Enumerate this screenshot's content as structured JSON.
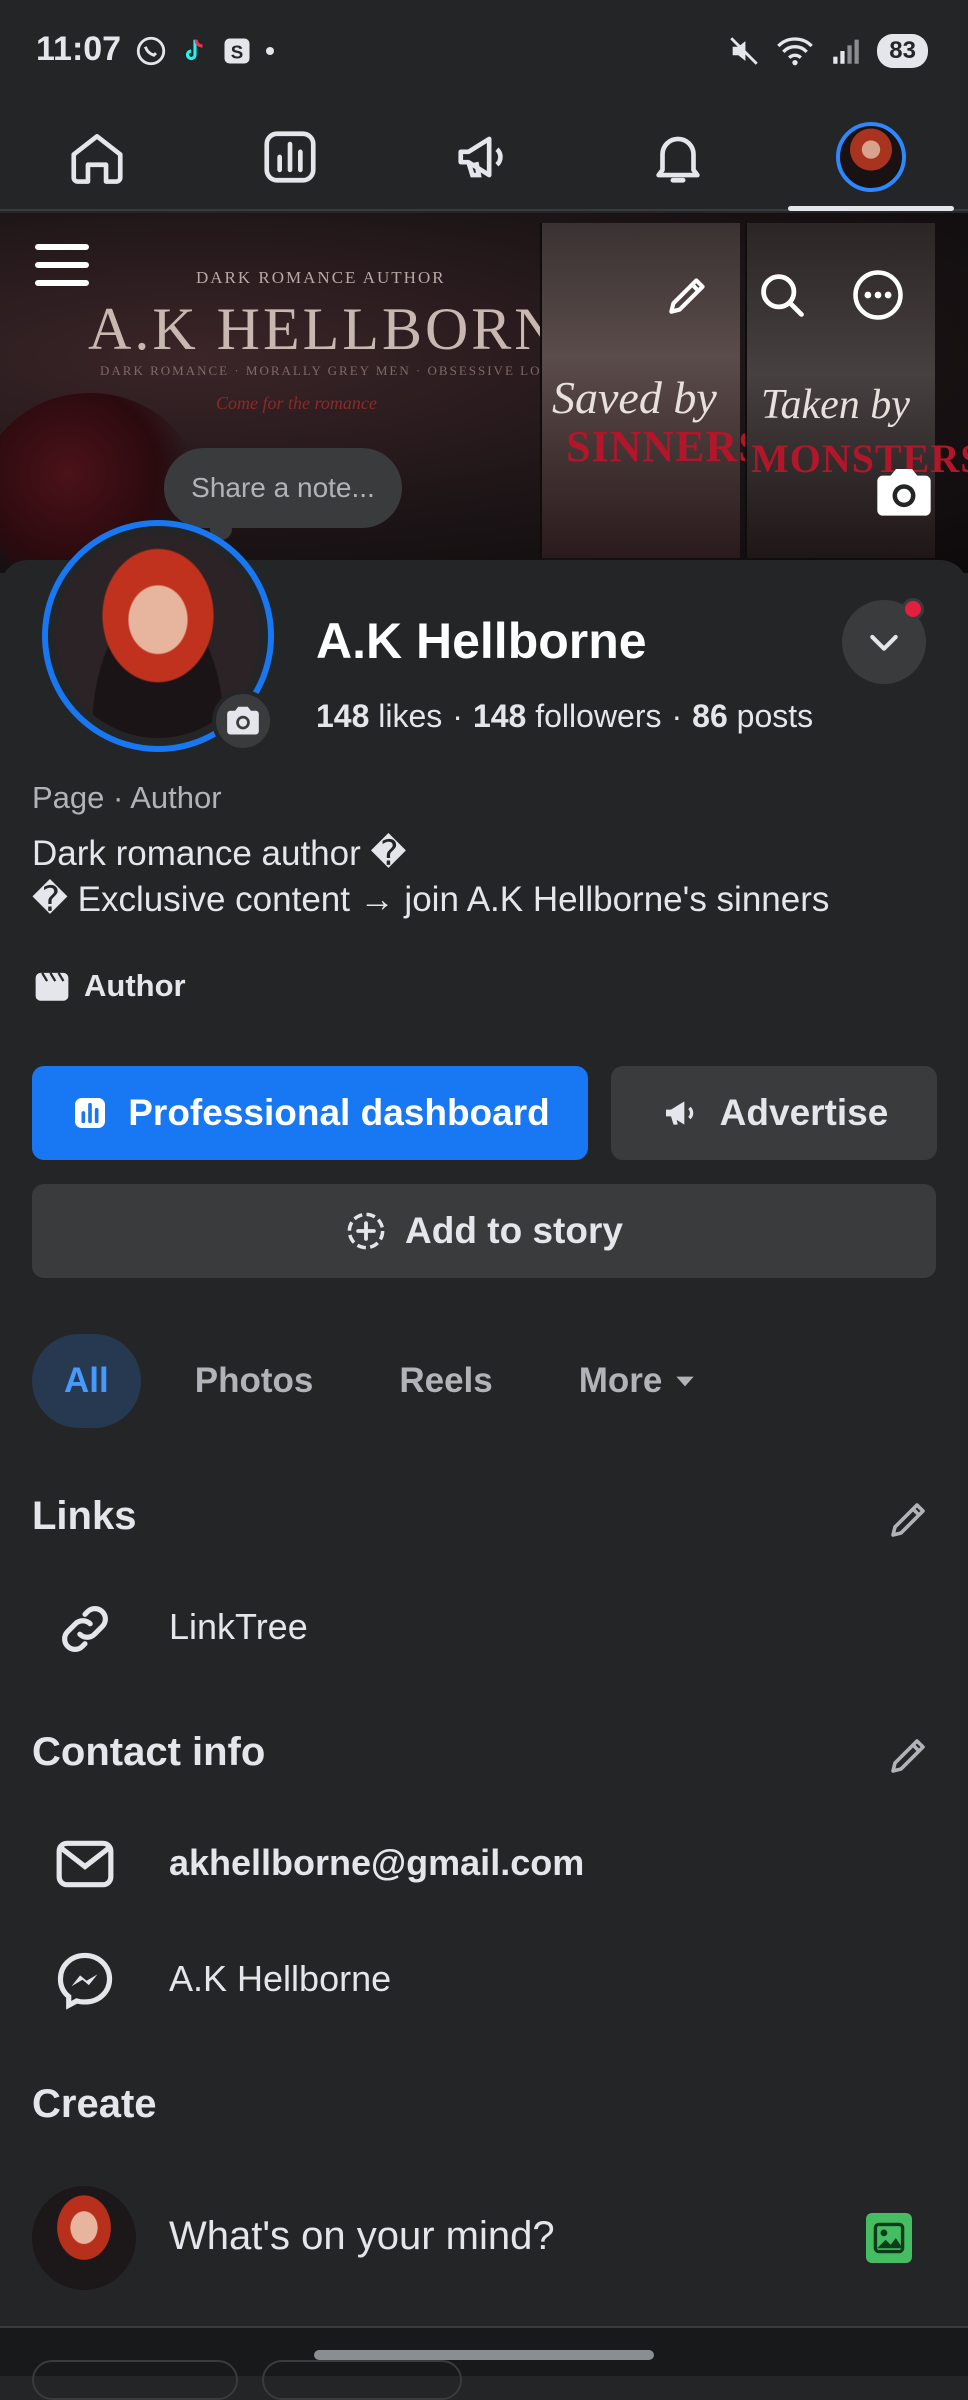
{
  "status_bar": {
    "time": "11:07",
    "battery": "83"
  },
  "nav": {
    "items": [
      {
        "name": "home-icon"
      },
      {
        "name": "dashboard-icon"
      },
      {
        "name": "megaphone-icon"
      },
      {
        "name": "bell-icon"
      },
      {
        "name": "profile-avatar"
      }
    ]
  },
  "cover": {
    "subtitle": "DARK ROMANCE AUTHOR",
    "title": "A.K HELLBORNE",
    "tagline": "DARK ROMANCE · MORALLY GREY MEN · OBSESSIVE LOVE",
    "script": "Come for the romance",
    "book1_script": "Saved by",
    "book1_red": "SINNERS",
    "book2_script": "Taken by",
    "book2_red": "MONSTERS"
  },
  "note": {
    "placeholder": "Share a note..."
  },
  "profile": {
    "name": "A.K Hellborne",
    "likes_count": "148",
    "likes_label": "likes",
    "followers_count": "148",
    "followers_label": "followers",
    "posts_count": "86",
    "posts_label": "posts",
    "category": "Page · Author",
    "bio_line1": "Dark romance author �",
    "bio_line2": "� Exclusive content  → join A.K Hellborne's sinners",
    "tag": "Author"
  },
  "actions": {
    "dashboard": "Professional dashboard",
    "advertise": "Advertise",
    "story": "Add to story"
  },
  "tabs": [
    {
      "label": "All",
      "active": true
    },
    {
      "label": "Photos"
    },
    {
      "label": "Reels"
    },
    {
      "label": "More"
    }
  ],
  "links": {
    "title": "Links",
    "items": [
      {
        "label": "LinkTree"
      }
    ]
  },
  "contact": {
    "title": "Contact info",
    "email": "akhellborne@gmail.com",
    "messenger": "A.K Hellborne"
  },
  "create": {
    "title": "Create",
    "prompt": "What's on your mind?"
  },
  "colors": {
    "background": "#242526",
    "accent": "#1877f2",
    "surface": "#3a3b3c",
    "tab_active_bg": "#263951",
    "tab_active_text": "#4599ff"
  }
}
